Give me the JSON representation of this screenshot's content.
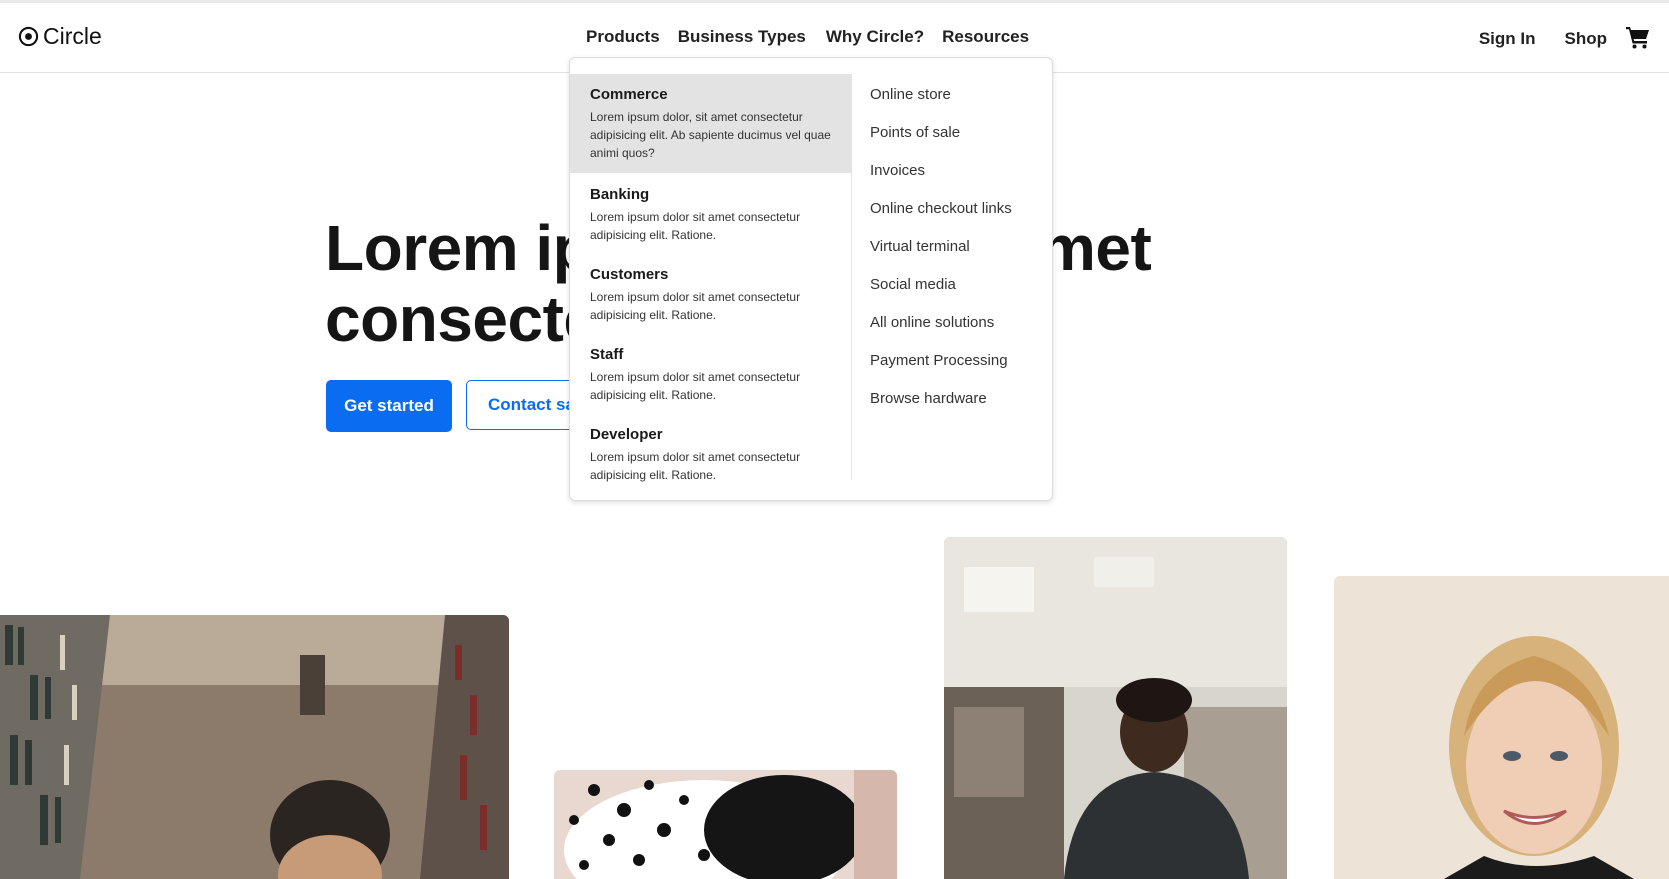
{
  "brand": {
    "name": "Circle"
  },
  "nav": {
    "items": [
      "Products",
      "Business Types",
      "Why Circle?",
      "Resources"
    ]
  },
  "right_nav": {
    "sign_in": "Sign In",
    "shop": "Shop",
    "cart_icon": "cart-icon"
  },
  "hero": {
    "title_line1": "Lorem ipsum dolor sit amet",
    "title_line2": "consectetur",
    "primary_button": "Get started",
    "secondary_button": "Contact sales"
  },
  "dropdown": {
    "categories": [
      {
        "title": "Commerce",
        "desc": "Lorem ipsum dolor, sit amet consectetur adipisicing elit. Ab sapiente ducimus vel quae animi quos?",
        "active": true
      },
      {
        "title": "Banking",
        "desc": "Lorem ipsum dolor sit amet consectetur adipisicing elit. Ratione."
      },
      {
        "title": "Customers",
        "desc": "Lorem ipsum dolor sit amet consectetur adipisicing elit. Ratione."
      },
      {
        "title": "Staff",
        "desc": "Lorem ipsum dolor sit amet consectetur adipisicing elit. Ratione."
      },
      {
        "title": "Developer",
        "desc": "Lorem ipsum dolor sit amet consectetur adipisicing elit. Ratione."
      }
    ],
    "links": [
      "Online store",
      "Points of sale",
      "Invoices",
      "Online checkout links",
      "Virtual terminal",
      "Social media",
      "All online solutions",
      "Payment Processing",
      "Browse hardware"
    ]
  },
  "colors": {
    "accent": "#0a6cf0",
    "active_bg": "#e3e3e3"
  }
}
